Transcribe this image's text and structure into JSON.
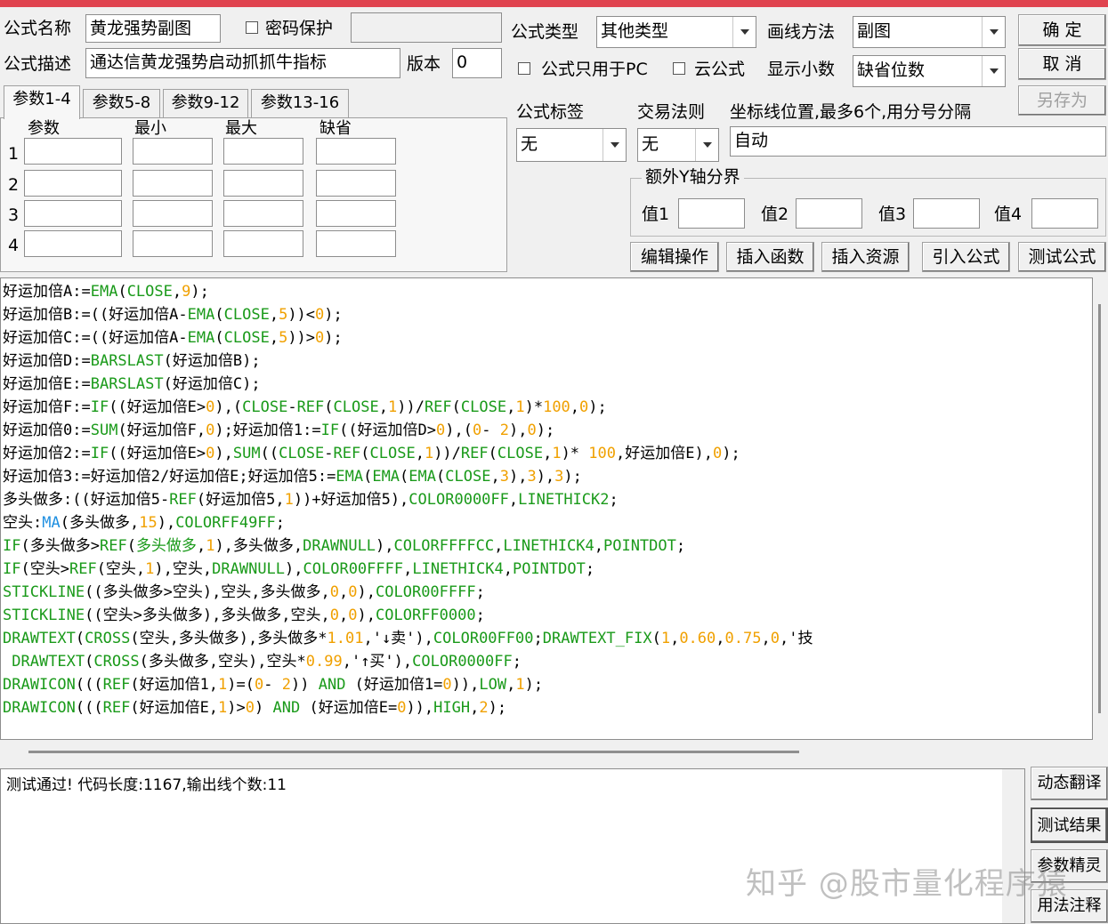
{
  "form": {
    "name_label": "公式名称",
    "name_value": "黄龙强势副图",
    "password_label": "密码保护",
    "password_value": "",
    "desc_label": "公式描述",
    "desc_value": "通达信黄龙强势启动抓抓牛指标",
    "version_label": "版本",
    "version_value": "0",
    "type_label": "公式类型",
    "type_value": "其他类型",
    "draw_label": "画线方法",
    "draw_value": "副图",
    "pc_only_label": "公式只用于PC",
    "cloud_label": "云公式",
    "decimal_label": "显示小数",
    "decimal_value": "缺省位数",
    "tag_label": "公式标签",
    "tag_value": "无",
    "rule_label": "交易法则",
    "rule_value": "无",
    "coord_label": "坐标线位置,最多6个,用分号分隔",
    "coord_value": "自动",
    "extra_y_label": "额外Y轴分界",
    "val1_label": "值1",
    "val2_label": "值2",
    "val3_label": "值3",
    "val4_label": "值4"
  },
  "buttons": {
    "ok": "确 定",
    "cancel": "取 消",
    "save_as": "另存为",
    "edit_op": "编辑操作",
    "insert_func": "插入函数",
    "insert_res": "插入资源",
    "import": "引入公式",
    "test": "测试公式",
    "dyn_translate": "动态翻译",
    "test_result": "测试结果",
    "param_wizard": "参数精灵",
    "usage_note": "用法注释"
  },
  "tabs": [
    "参数1-4",
    "参数5-8",
    "参数9-12",
    "参数13-16"
  ],
  "params": {
    "headers": [
      "参数",
      "最小",
      "最大",
      "缺省"
    ],
    "rows": [
      "1",
      "2",
      "3",
      "4"
    ]
  },
  "code": [
    [
      [
        "好运加倍A:=",
        ""
      ],
      [
        "EMA",
        "kw"
      ],
      [
        "(",
        ""
      ],
      [
        "CLOSE",
        "kw"
      ],
      [
        ",",
        ""
      ],
      [
        "9",
        "num"
      ],
      [
        ");",
        ""
      ]
    ],
    [
      [
        "好运加倍B:=((好运加倍A-",
        ""
      ],
      [
        "EMA",
        "kw"
      ],
      [
        "(",
        ""
      ],
      [
        "CLOSE",
        "kw"
      ],
      [
        ",",
        ""
      ],
      [
        "5",
        "num"
      ],
      [
        "))<",
        ""
      ],
      [
        "0",
        "num"
      ],
      [
        ");",
        ""
      ]
    ],
    [
      [
        "好运加倍C:=((好运加倍A-",
        ""
      ],
      [
        "EMA",
        "kw"
      ],
      [
        "(",
        ""
      ],
      [
        "CLOSE",
        "kw"
      ],
      [
        ",",
        ""
      ],
      [
        "5",
        "num"
      ],
      [
        "))>",
        ""
      ],
      [
        "0",
        "num"
      ],
      [
        ");",
        ""
      ]
    ],
    [
      [
        "好运加倍D:=",
        ""
      ],
      [
        "BARSLAST",
        "kw"
      ],
      [
        "(好运加倍B);",
        ""
      ]
    ],
    [
      [
        "好运加倍E:=",
        ""
      ],
      [
        "BARSLAST",
        "kw"
      ],
      [
        "(好运加倍C);",
        ""
      ]
    ],
    [
      [
        "好运加倍F:=",
        ""
      ],
      [
        "IF",
        "kw"
      ],
      [
        "((好运加倍E>",
        ""
      ],
      [
        "0",
        "num"
      ],
      [
        "),(",
        ""
      ],
      [
        "CLOSE",
        "kw"
      ],
      [
        "-",
        ""
      ],
      [
        "REF",
        "kw"
      ],
      [
        "(",
        ""
      ],
      [
        "CLOSE",
        "kw"
      ],
      [
        ",",
        ""
      ],
      [
        "1",
        "num"
      ],
      [
        "))/",
        ""
      ],
      [
        "REF",
        "kw"
      ],
      [
        "(",
        ""
      ],
      [
        "CLOSE",
        "kw"
      ],
      [
        ",",
        ""
      ],
      [
        "1",
        "num"
      ],
      [
        ")*",
        ""
      ],
      [
        "100",
        "num"
      ],
      [
        ",",
        ""
      ],
      [
        "0",
        "num"
      ],
      [
        ");",
        ""
      ]
    ],
    [
      [
        "好运加倍0:=",
        ""
      ],
      [
        "SUM",
        "kw"
      ],
      [
        "(好运加倍F,",
        ""
      ],
      [
        "0",
        "num"
      ],
      [
        ");好运加倍1:=",
        ""
      ],
      [
        "IF",
        "kw"
      ],
      [
        "((好运加倍D>",
        ""
      ],
      [
        "0",
        "num"
      ],
      [
        "),(",
        ""
      ],
      [
        "0",
        "num"
      ],
      [
        "- ",
        ""
      ],
      [
        "2",
        "num"
      ],
      [
        "),",
        ""
      ],
      [
        "0",
        "num"
      ],
      [
        ");",
        ""
      ]
    ],
    [
      [
        "好运加倍2:=",
        ""
      ],
      [
        "IF",
        "kw"
      ],
      [
        "((好运加倍E>",
        ""
      ],
      [
        "0",
        "num"
      ],
      [
        "),",
        ""
      ],
      [
        "SUM",
        "kw"
      ],
      [
        "((",
        ""
      ],
      [
        "CLOSE",
        "kw"
      ],
      [
        "-",
        ""
      ],
      [
        "REF",
        "kw"
      ],
      [
        "(",
        ""
      ],
      [
        "CLOSE",
        "kw"
      ],
      [
        ",",
        ""
      ],
      [
        "1",
        "num"
      ],
      [
        "))/",
        ""
      ],
      [
        "REF",
        "kw"
      ],
      [
        "(",
        ""
      ],
      [
        "CLOSE",
        "kw"
      ],
      [
        ",",
        ""
      ],
      [
        "1",
        "num"
      ],
      [
        ")* ",
        ""
      ],
      [
        "100",
        "num"
      ],
      [
        ",好运加倍E),",
        ""
      ],
      [
        "0",
        "num"
      ],
      [
        ");",
        ""
      ]
    ],
    [
      [
        "好运加倍3:=好运加倍2/好运加倍E;好运加倍5:=",
        ""
      ],
      [
        "EMA",
        "kw"
      ],
      [
        "(",
        ""
      ],
      [
        "EMA",
        "kw"
      ],
      [
        "(",
        ""
      ],
      [
        "EMA",
        "kw"
      ],
      [
        "(",
        ""
      ],
      [
        "CLOSE",
        "kw"
      ],
      [
        ",",
        ""
      ],
      [
        "3",
        "num"
      ],
      [
        "),",
        ""
      ],
      [
        "3",
        "num"
      ],
      [
        "),",
        ""
      ],
      [
        "3",
        "num"
      ],
      [
        ");",
        ""
      ]
    ],
    [
      [
        "多头做多:((好运加倍5-",
        ""
      ],
      [
        "REF",
        "kw"
      ],
      [
        "(好运加倍5,",
        ""
      ],
      [
        "1",
        "num"
      ],
      [
        "))+好运加倍5),",
        ""
      ],
      [
        "COLOR0000FF",
        "kw"
      ],
      [
        ",",
        ""
      ],
      [
        "LINETHICK2",
        "kw"
      ],
      [
        ";",
        ""
      ]
    ],
    [
      [
        "空头:",
        ""
      ],
      [
        "MA",
        "fn"
      ],
      [
        "(多头做多,",
        ""
      ],
      [
        "15",
        "num"
      ],
      [
        "),",
        ""
      ],
      [
        "COLORFF49FF",
        "kw"
      ],
      [
        ";",
        ""
      ]
    ],
    [
      [
        "IF",
        "kw"
      ],
      [
        "(多头做多>",
        ""
      ],
      [
        "REF",
        "kw"
      ],
      [
        "(",
        ""
      ],
      [
        "多头做多",
        "kw"
      ],
      [
        ",",
        ""
      ],
      [
        "1",
        "num"
      ],
      [
        "),多头做多,",
        ""
      ],
      [
        "DRAWNULL",
        "kw"
      ],
      [
        "),",
        ""
      ],
      [
        "COLORFFFFCC",
        "kw"
      ],
      [
        ",",
        ""
      ],
      [
        "LINETHICK4",
        "kw"
      ],
      [
        ",",
        ""
      ],
      [
        "POINTDOT",
        "kw"
      ],
      [
        ";",
        ""
      ]
    ],
    [
      [
        "IF",
        "kw"
      ],
      [
        "(空头>",
        ""
      ],
      [
        "REF",
        "kw"
      ],
      [
        "(空头,",
        ""
      ],
      [
        "1",
        "num"
      ],
      [
        "),空头,",
        ""
      ],
      [
        "DRAWNULL",
        "kw"
      ],
      [
        "),",
        ""
      ],
      [
        "COLOR00FFFF",
        "kw"
      ],
      [
        ",",
        ""
      ],
      [
        "LINETHICK4",
        "kw"
      ],
      [
        ",",
        ""
      ],
      [
        "POINTDOT",
        "kw"
      ],
      [
        ";",
        ""
      ]
    ],
    [
      [
        "STICKLINE",
        "kw"
      ],
      [
        "((多头做多>空头),空头,多头做多,",
        ""
      ],
      [
        "0",
        "num"
      ],
      [
        ",",
        ""
      ],
      [
        "0",
        "num"
      ],
      [
        "),",
        ""
      ],
      [
        "COLOR00FFFF",
        "kw"
      ],
      [
        ";",
        ""
      ]
    ],
    [
      [
        "STICKLINE",
        "kw"
      ],
      [
        "((空头>多头做多),多头做多,空头,",
        ""
      ],
      [
        "0",
        "num"
      ],
      [
        ",",
        ""
      ],
      [
        "0",
        "num"
      ],
      [
        "),",
        ""
      ],
      [
        "COLORFF0000",
        "kw"
      ],
      [
        ";",
        ""
      ]
    ],
    [
      [
        "DRAWTEXT",
        "kw"
      ],
      [
        "(",
        ""
      ],
      [
        "CROSS",
        "kw"
      ],
      [
        "(空头,多头做多),多头做多*",
        ""
      ],
      [
        "1.01",
        "num"
      ],
      [
        ",'↓卖'),",
        ""
      ],
      [
        "COLOR00FF00",
        "kw"
      ],
      [
        ";",
        ""
      ],
      [
        "DRAWTEXT_FIX",
        "kw"
      ],
      [
        "(",
        ""
      ],
      [
        "1",
        "num"
      ],
      [
        ",",
        ""
      ],
      [
        "0.60",
        "num"
      ],
      [
        ",",
        ""
      ],
      [
        "0.75",
        "num"
      ],
      [
        ",",
        ""
      ],
      [
        "0",
        "num"
      ],
      [
        ",'技",
        ""
      ]
    ],
    [
      [
        " ",
        ""
      ],
      [
        "DRAWTEXT",
        "kw"
      ],
      [
        "(",
        ""
      ],
      [
        "CROSS",
        "kw"
      ],
      [
        "(多头做多,空头),空头*",
        ""
      ],
      [
        "0.99",
        "num"
      ],
      [
        ",'↑买'),",
        ""
      ],
      [
        "COLOR0000FF",
        "kw"
      ],
      [
        ";",
        ""
      ]
    ],
    [
      [
        "DRAWICON",
        "kw"
      ],
      [
        "(((",
        ""
      ],
      [
        "REF",
        "kw"
      ],
      [
        "(好运加倍1,",
        ""
      ],
      [
        "1",
        "num"
      ],
      [
        ")=(",
        ""
      ],
      [
        "0",
        "num"
      ],
      [
        "- ",
        ""
      ],
      [
        "2",
        "num"
      ],
      [
        ")) ",
        ""
      ],
      [
        "AND",
        "kw"
      ],
      [
        " (好运加倍1=",
        ""
      ],
      [
        "0",
        "num"
      ],
      [
        ")),",
        ""
      ],
      [
        "LOW",
        "kw"
      ],
      [
        ",",
        ""
      ],
      [
        "1",
        "num"
      ],
      [
        ");",
        ""
      ]
    ],
    [
      [
        "DRAWICON",
        "kw"
      ],
      [
        "(((",
        ""
      ],
      [
        "REF",
        "kw"
      ],
      [
        "(好运加倍E,",
        ""
      ],
      [
        "1",
        "num"
      ],
      [
        ")>",
        ""
      ],
      [
        "0",
        "num"
      ],
      [
        ") ",
        ""
      ],
      [
        "AND",
        "kw"
      ],
      [
        " (好运加倍E=",
        ""
      ],
      [
        "0",
        "num"
      ],
      [
        ")),",
        ""
      ],
      [
        "HIGH",
        "kw"
      ],
      [
        ",",
        ""
      ],
      [
        "2",
        "num"
      ],
      [
        ");",
        ""
      ]
    ]
  ],
  "result_text": "测试通过! 代码长度:1167,输出线个数:11",
  "watermark": "知乎 @股市量化程序猿",
  "colors": {
    "keyword": "#1a9a1a",
    "function": "#1f8fe0",
    "number": "#f0a000",
    "title_strip": "#e0434f"
  }
}
